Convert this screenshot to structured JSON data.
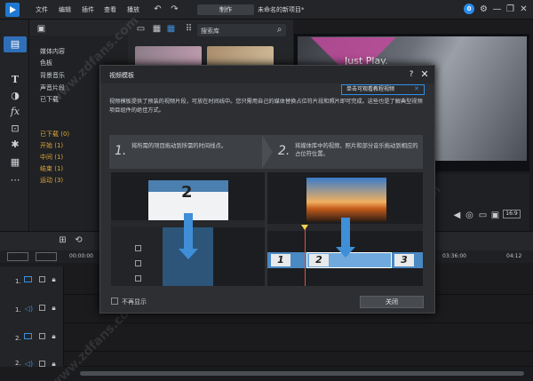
{
  "app": {
    "menu": [
      "文件",
      "编辑",
      "插件",
      "查看",
      "播放"
    ],
    "produce_label": "制作",
    "project_name": "未命名的新项目*",
    "badge": "0"
  },
  "library": {
    "search_placeholder": "搜索库",
    "tree": [
      "媒体内容",
      "色板",
      "背景音乐",
      "声音片段",
      "已下载"
    ],
    "sub_tree": [
      "已下载  (0)",
      "开始  (1)",
      "中间  (1)",
      "结束  (1)",
      "运动  (3)"
    ]
  },
  "preview": {
    "text": "Just Play.",
    "aspect": "16:9"
  },
  "timeline": {
    "ruler": [
      "00:00:00",
      "03:36:00",
      "04:12"
    ],
    "tracks": [
      "1.",
      "1.",
      "2.",
      "2."
    ]
  },
  "dialog": {
    "title": "视频模板",
    "tooltip": "单击可观看教程视频",
    "description": "视频模板提供了预装的视频片段，可放在时间线中。您只需用自己的媒体替换占位符片段和照片即可完成。这些也是了解典型视频项目组件的绝佳方式。",
    "step1_num": "1.",
    "step1_text": "将所需的项目拖动到所需的时间线点。",
    "step2_num": "2.",
    "step2_text": "将媒体库中的视频、照片和部分音乐拖动到相应的占位符位置。",
    "slide_num": "2",
    "clips": [
      "1",
      "2",
      "3"
    ],
    "no_display_label": "不再显示",
    "close_label": "关闭"
  },
  "watermark": "www.zdfans.com",
  "colors": {
    "accent": "#2f8fe6",
    "clip_blue": "#4a89c2",
    "sub_item": "#e0a63c"
  }
}
